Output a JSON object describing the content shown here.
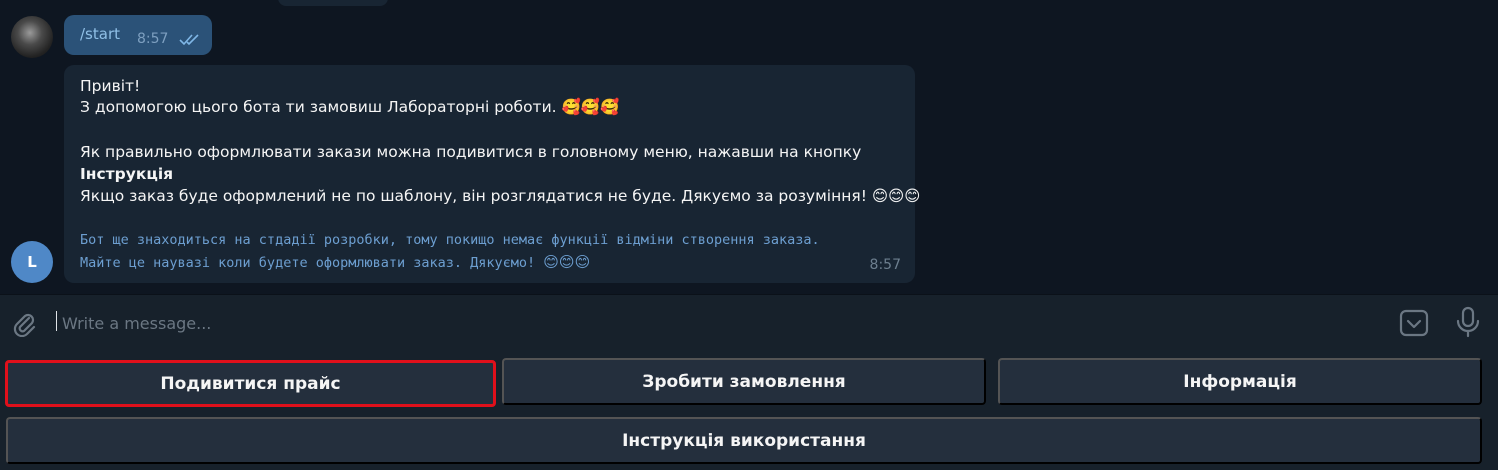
{
  "history": {
    "outgoing": {
      "text": "/start",
      "time": "8:57"
    },
    "incoming": {
      "line1": "Привіт!",
      "line2": "З допомогою цього бота ти замовиш Лабораторні роботи.",
      "line2_emoji": "🥰🥰🥰",
      "line3": "Як правильно оформлювати закази можна подивитися в головному меню, нажавши на кнопку",
      "line4_bold": "Інструкція",
      "line5": "Якщо заказ буде оформлений не по шаблону, він розглядатися не буде. Дякуємо за розуміння!",
      "line5_emoji": "😊😊😊",
      "note1": "Бот ще знаходиться на стдадії розробки, тому покищо немає функції відміни створення заказа.",
      "note2": "Майте це наувазі коли будете оформлювати заказ. Дякуємо!",
      "note2_emoji": "😊😊😊",
      "time": "8:57",
      "avatar_letter": "L"
    }
  },
  "composer": {
    "placeholder": "Write a message..."
  },
  "keyboard": {
    "row1": [
      "Подивитися прайс",
      "Зробити замовлення",
      "Інформація"
    ],
    "row2": [
      "Інструкція використання"
    ]
  },
  "colors": {
    "highlight": "#e0101b",
    "bubble_out": "#2b5278",
    "bubble_in": "#182533"
  }
}
